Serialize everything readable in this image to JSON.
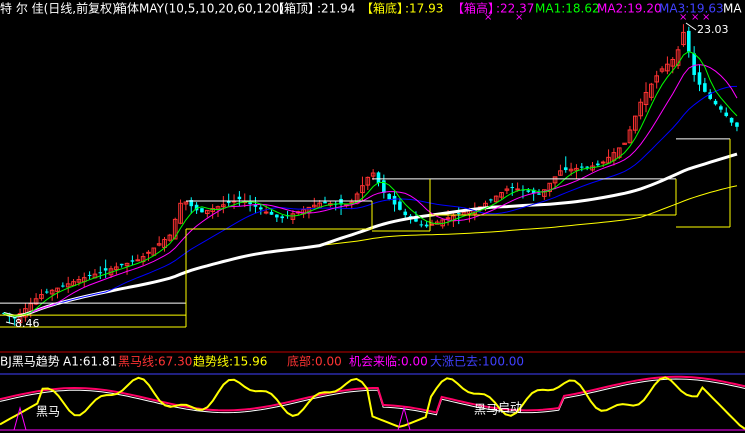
{
  "header": {
    "stock_name": "特 尔 佳(日线,前复权)",
    "indicator": "箱体MAY(10,5,10,20,60,120)",
    "box_top_label": "【箱顶】",
    "box_top_value": ":21.94",
    "box_bottom_label": "【箱底】",
    "box_bottom_value": ":17.93",
    "box_high_label": "【箱高】",
    "box_high_value": ":22.37",
    "ma1": "MA1:18.62",
    "ma2": "MA2:19.20",
    "ma3": "MA3:19.63",
    "ma_more": "MA"
  },
  "sub_header": {
    "name": "BJ黑马趋势",
    "a1": "A1:61.81",
    "heima": "黑马线:67.30",
    "trend": "趋势线:15.96",
    "bottom": "底部:0.00",
    "chance": "机会来临:0.00",
    "rise": "大涨已去:100.00"
  },
  "colors": {
    "up": "#ff3232",
    "down": "#00ffff",
    "ma_fast": "#ffffff",
    "ma_green": "#00ff00",
    "ma_magenta": "#ff00ff",
    "ma_blue": "#0000ff",
    "ma_thick": "#ffffff",
    "ma_yellow": "#ffff00"
  },
  "chart_data": {
    "type": "candlestick",
    "price_range": [
      7.5,
      24.5
    ],
    "price_annotations": [
      {
        "text": "23.03",
        "price": 23.03
      },
      {
        "text": "8.46",
        "price": 8.46
      }
    ],
    "sub_markers": [
      "黑马",
      "黑马",
      "启动"
    ],
    "sub_range": [
      0,
      100
    ],
    "highlight_markers": "×"
  }
}
